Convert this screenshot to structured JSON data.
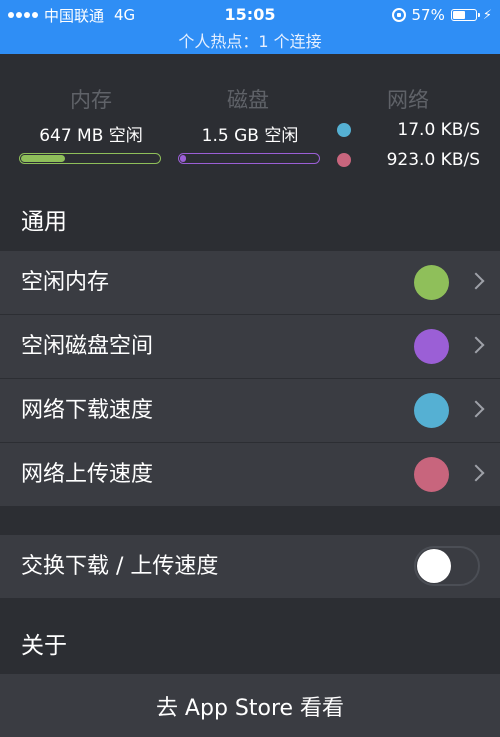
{
  "status_bar": {
    "carrier": "中国联通",
    "network": "4G",
    "time": "15:05",
    "battery_text": "57%",
    "battery_level": 0.57,
    "hotspot": "个人热点：1 个连接"
  },
  "stats": {
    "memory": {
      "title": "内存",
      "value": "647 MB 空闲",
      "fraction": 0.32,
      "color": "#8fbf5a"
    },
    "disk": {
      "title": "磁盘",
      "value": "1.5 GB 空闲",
      "fraction": 0.04,
      "color": "#9b5fd6"
    },
    "network": {
      "title": "网络",
      "download": "17.0 KB/S",
      "upload": "923.0 KB/S",
      "download_color": "#55b0d3",
      "upload_color": "#c8657d"
    }
  },
  "general": {
    "header": "通用",
    "rows": [
      {
        "label": "空闲内存",
        "color": "#8fbf5a"
      },
      {
        "label": "空闲磁盘空间",
        "color": "#9b5fd6"
      },
      {
        "label": "网络下载速度",
        "color": "#55b0d3"
      },
      {
        "label": "网络上传速度",
        "color": "#c8657d"
      }
    ]
  },
  "swap": {
    "label": "交换下载 / 上传速度",
    "enabled": false
  },
  "about": {
    "header": "关于",
    "appstore": "去 App Store 看看"
  }
}
